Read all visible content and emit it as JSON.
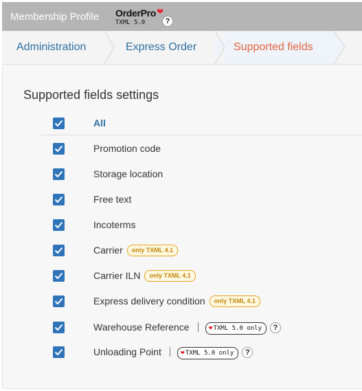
{
  "header": {
    "title": "Membership Profile",
    "logo_name": "OrderPro",
    "logo_version": "TXML 5.0",
    "help_label": "?"
  },
  "breadcrumb": [
    {
      "label": "Administration",
      "active": false
    },
    {
      "label": "Express Order",
      "active": false
    },
    {
      "label": "Supported fields",
      "active": true
    }
  ],
  "section": {
    "title": "Supported fields settings"
  },
  "fields": {
    "all": {
      "label": "All",
      "checked": true
    },
    "items": [
      {
        "label": "Promotion code",
        "checked": true
      },
      {
        "label": "Storage location",
        "checked": true
      },
      {
        "label": "Free text",
        "checked": true
      },
      {
        "label": "Incoterms",
        "checked": true
      },
      {
        "label": "Carrier",
        "checked": true,
        "badge": "only TXML 4.1"
      },
      {
        "label": "Carrier ILN",
        "checked": true,
        "badge": "only TXML 4.1"
      },
      {
        "label": "Express delivery condition",
        "checked": true,
        "badge": "only TXML 4.1"
      },
      {
        "label": "Warehouse Reference",
        "checked": true,
        "txml_badge": "TXML 5.0 only",
        "help": "?"
      },
      {
        "label": "Unloading Point",
        "checked": true,
        "txml_badge": "TXML 5.0 only",
        "help": "?"
      }
    ]
  },
  "colors": {
    "accent": "#2f74b8",
    "link": "#2d6f9f",
    "active_crumb": "#e4643c",
    "badge_yellow": "#e6a51e",
    "heart": "#e8212e"
  }
}
